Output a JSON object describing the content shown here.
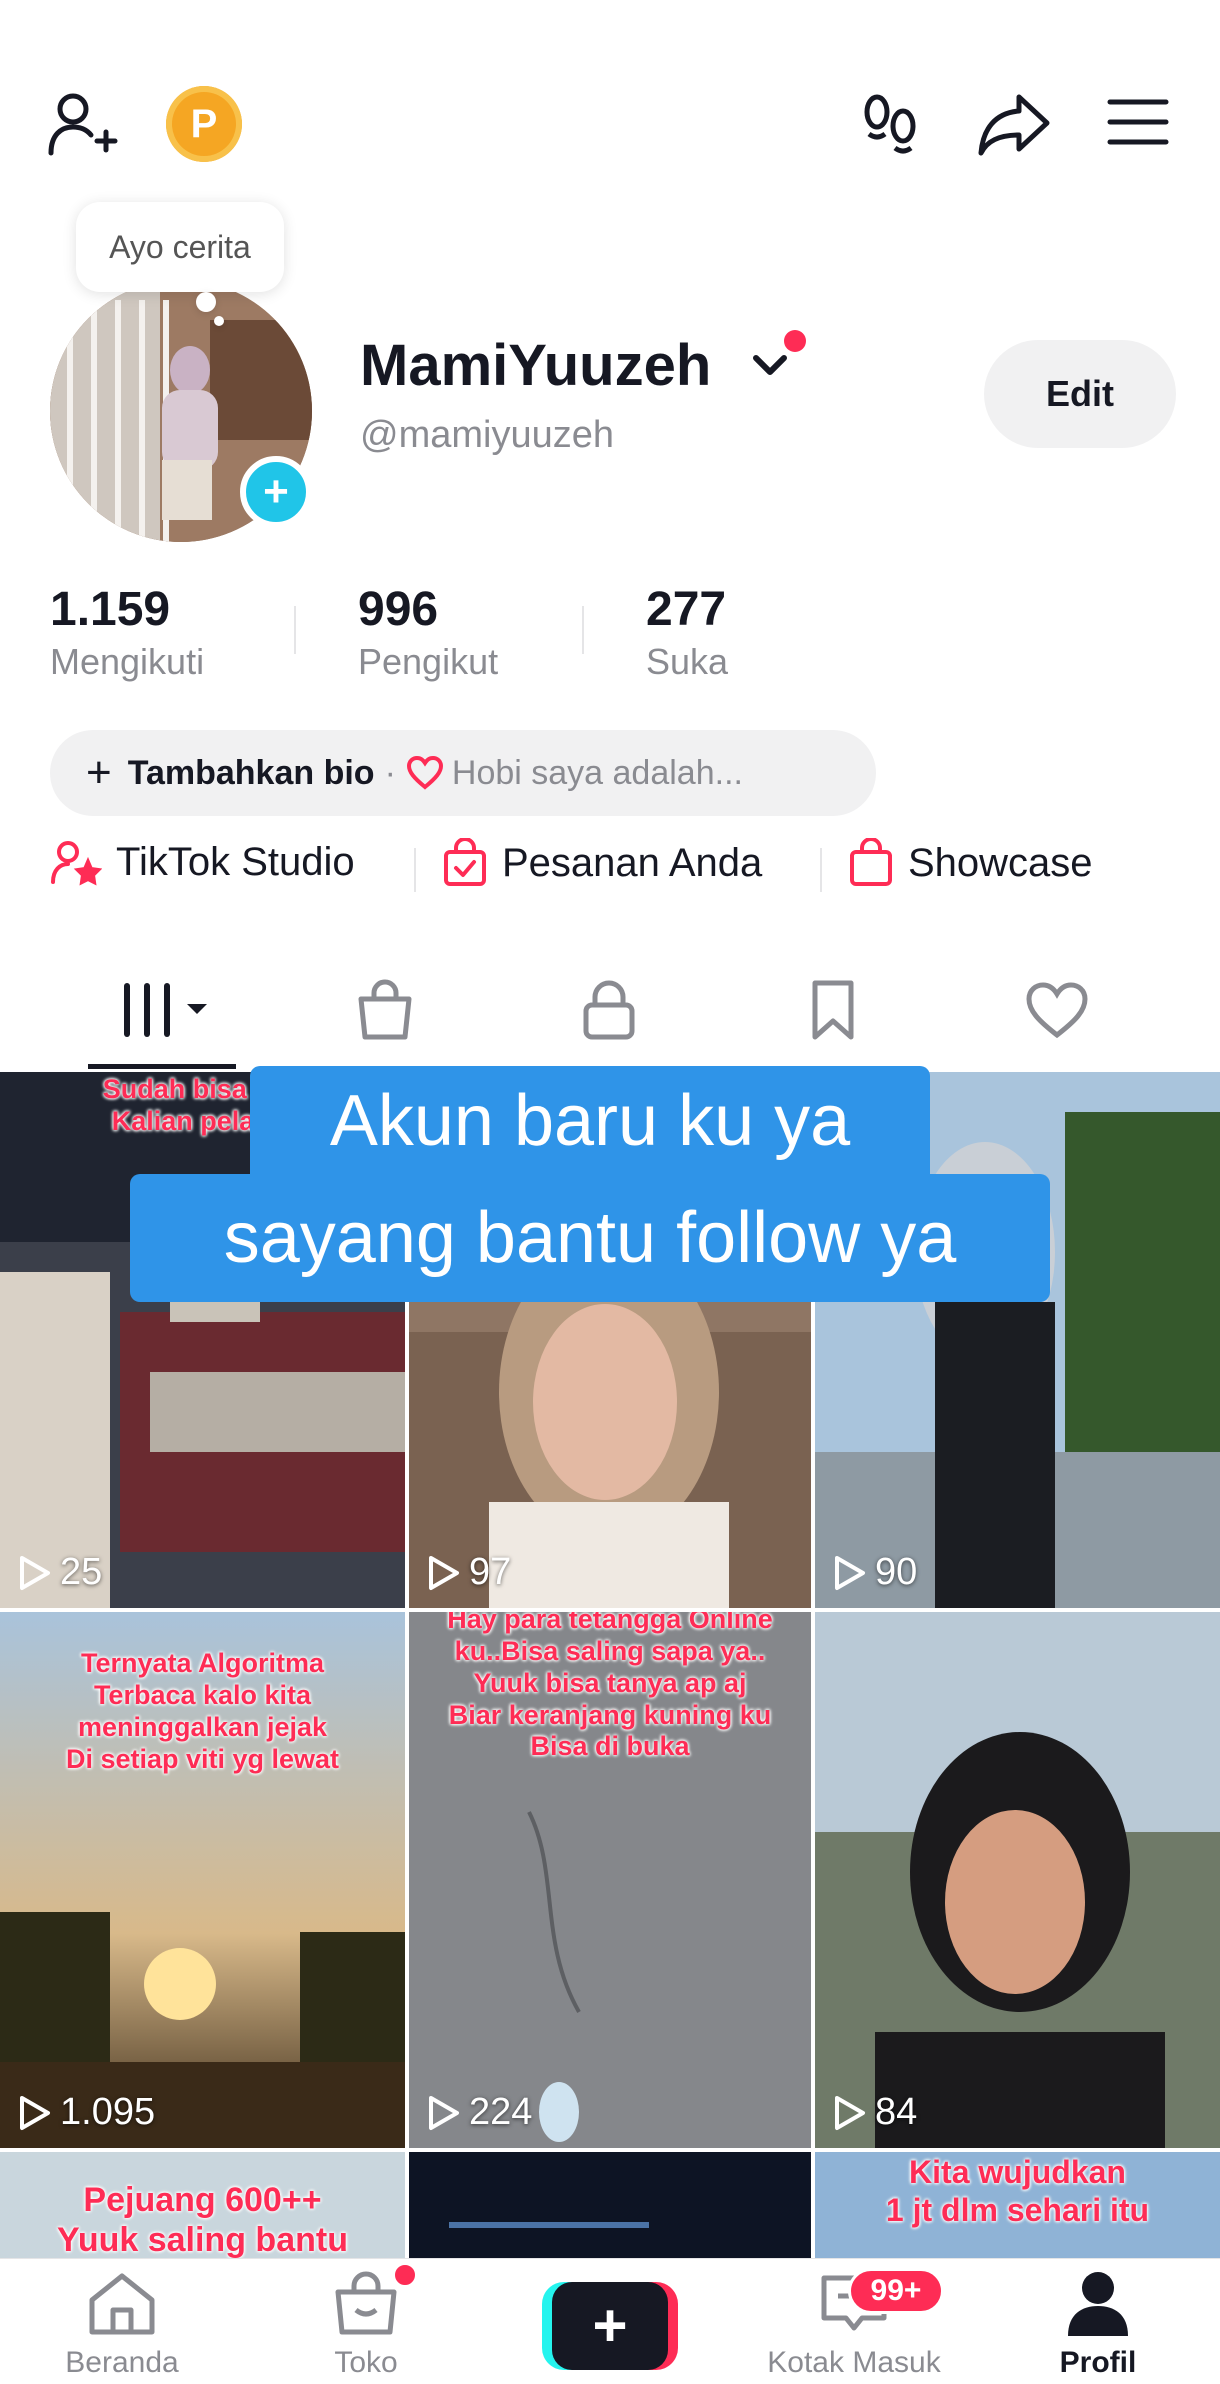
{
  "header": {
    "add_friend_icon": "person-plus-icon",
    "coin_label": "P",
    "footprint_icon": "footprints-icon",
    "share_icon": "share-arrow-icon",
    "menu_icon": "hamburger-menu-icon"
  },
  "profile": {
    "bubble_text": "Ayo cerita",
    "display_name": "MamiYuuzeh",
    "handle": "@mamiyuuzeh",
    "edit_label": "Edit",
    "stats": [
      {
        "value": "1.159",
        "label": "Mengikuti"
      },
      {
        "value": "996",
        "label": "Pengikut"
      },
      {
        "value": "277",
        "label": "Suka"
      }
    ],
    "bio_add": "Tambahkan bio",
    "bio_sep": "·",
    "bio_hint": "Hobi saya adalah..."
  },
  "links": [
    {
      "label": "TikTok Studio",
      "icon": "person-star-icon"
    },
    {
      "label": "Pesanan Anda",
      "icon": "bag-check-icon"
    },
    {
      "label": "Showcase",
      "icon": "shopping-bag-icon"
    }
  ],
  "tabs": [
    "videos-grid-icon",
    "shop-bag-icon",
    "lock-icon",
    "bookmark-icon",
    "heart-icon"
  ],
  "overlay": {
    "line1": "Akun baru ku ya",
    "line2": "sayang bantu follow ya"
  },
  "videos": [
    {
      "views": "25",
      "caption": "Sudah bisa folll\nKalian pelan 2"
    },
    {
      "views": "97",
      "caption": ""
    },
    {
      "views": "90",
      "caption": ""
    },
    {
      "views": "1.095",
      "caption": "Ternyata Algoritma\nTerbaca kalo kita\nmeninggalkan jejak\nDi setiap viti yg lewat"
    },
    {
      "views": "224",
      "caption": "Hay para tetangga Online\nku..Bisa saling sapa ya..\nYuuk bisa tanya ap aj\nBiar keranjang kuning ku\nBisa di buka"
    },
    {
      "views": "84",
      "caption": ""
    },
    {
      "views": "",
      "caption": "Pejuang 600++\nYuuk saling bantu"
    },
    {
      "views": "",
      "caption": ""
    },
    {
      "views": "",
      "caption": "Kita wujudkan\n1 jt dlm sehari itu"
    }
  ],
  "nav": {
    "home": "Beranda",
    "shop": "Toko",
    "inbox": "Kotak Masuk",
    "inbox_badge": "99+",
    "profile": "Profil",
    "create": "+"
  },
  "colors": {
    "accent": "#fe2c55",
    "cyan": "#25f4ee",
    "overlay_blue": "#2f94e8",
    "coin": "#f5a623"
  }
}
